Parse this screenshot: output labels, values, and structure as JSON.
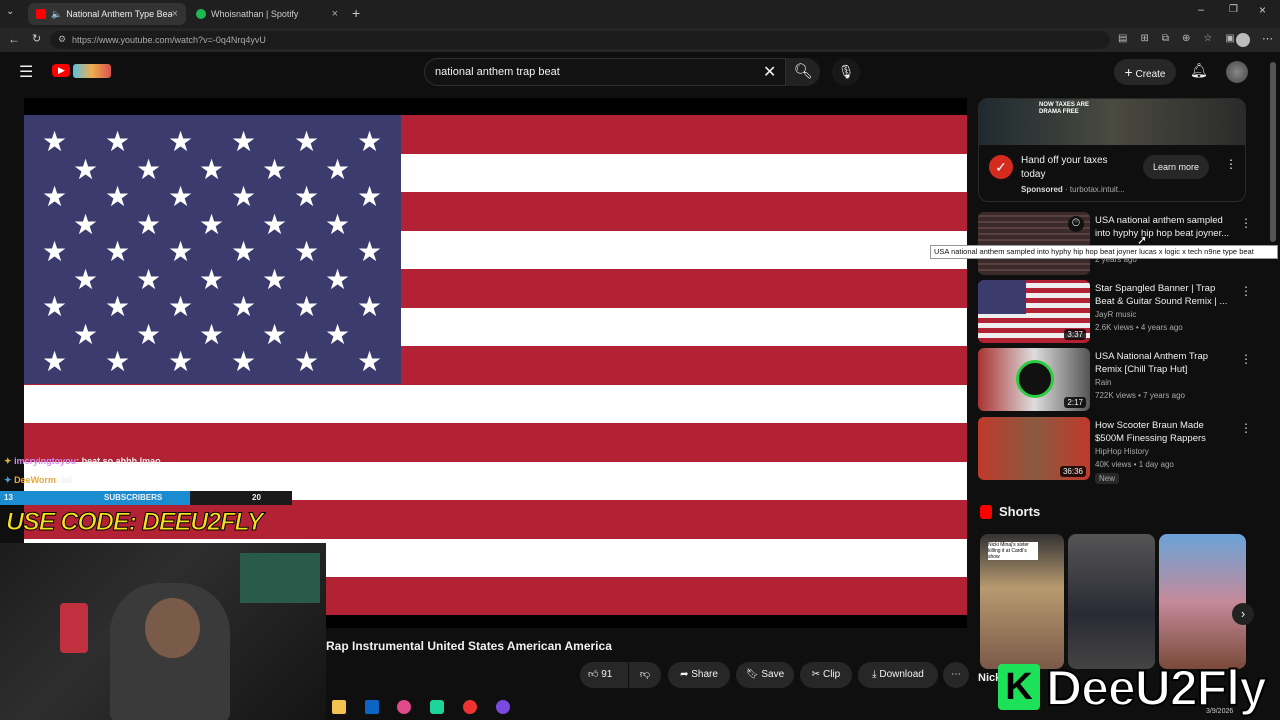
{
  "browser": {
    "tabs": [
      {
        "title": "National Anthem Type Beat Tr",
        "active": true
      },
      {
        "title": "Whoisnathan | Spotify",
        "active": false
      }
    ],
    "url": "https://www.youtube.com/watch?v=-0q4Nrq4yvU"
  },
  "header": {
    "search_value": "national anthem trap beat",
    "create_label": "Create"
  },
  "ad": {
    "title": "Hand off your taxes today",
    "sponsored": "Sponsored",
    "domain": "turbotax.intuit...",
    "cta": "Learn more",
    "thumb_text": "NOW TAXES ARE DRAMA FREE"
  },
  "recs": [
    {
      "title": "USA national anthem sampled into hyphy hip hop beat joyner...",
      "channel": "",
      "meta": "2 years ago",
      "duration": ""
    },
    {
      "title": "Star Spangled Banner | Trap Beat & Guitar Sound Remix | ...",
      "channel": "JayR music",
      "meta": "2.6K views • 4 years ago",
      "duration": "3:37"
    },
    {
      "title": "USA National Anthem Trap Remix [Chill Trap Hut]",
      "channel": "Rain",
      "meta": "722K views • 7 years ago",
      "duration": "2:17"
    },
    {
      "title": "How Scooter Braun Made $500M Finessing Rappers",
      "channel": "HipHop History",
      "meta": "40K views • 1 day ago",
      "duration": "36:36",
      "badge": "New"
    }
  ],
  "tooltip": "USA national anthem sampled into hyphy hip hop beat joyner lucas x logic x tech n9ne type beat",
  "shorts_label": "Shorts",
  "shorts": [
    {
      "caption": "Nicki Minaj's sister killing it at Cardi's show"
    },
    {
      "caption": ""
    },
    {
      "caption": ""
    }
  ],
  "shorts_bottom_text": "Nick",
  "video_title": "Rap Instrumental United States American America",
  "actions": {
    "likes": "91",
    "share": "Share",
    "save": "Save",
    "clip": "Clip",
    "download": "Download"
  },
  "overlay": {
    "chat": [
      {
        "user": "imcryingtoyou",
        "msg": ": beat so ahhh lmao"
      },
      {
        "user": "DeeWorm",
        "msg": ": lol"
      }
    ],
    "sub_left": "13",
    "sub_label": "SUBSCRIBERS",
    "sub_right": "20",
    "code": "USE CODE: DEEU2FLY",
    "brand": "DeeU2Fly"
  },
  "taskbar": {
    "date": "3/9/2026"
  },
  "colors": {
    "accent_red": "#ff0000",
    "flag_red": "#b22234",
    "flag_blue": "#3c3b6e",
    "brand_green": "#1ee15a"
  }
}
